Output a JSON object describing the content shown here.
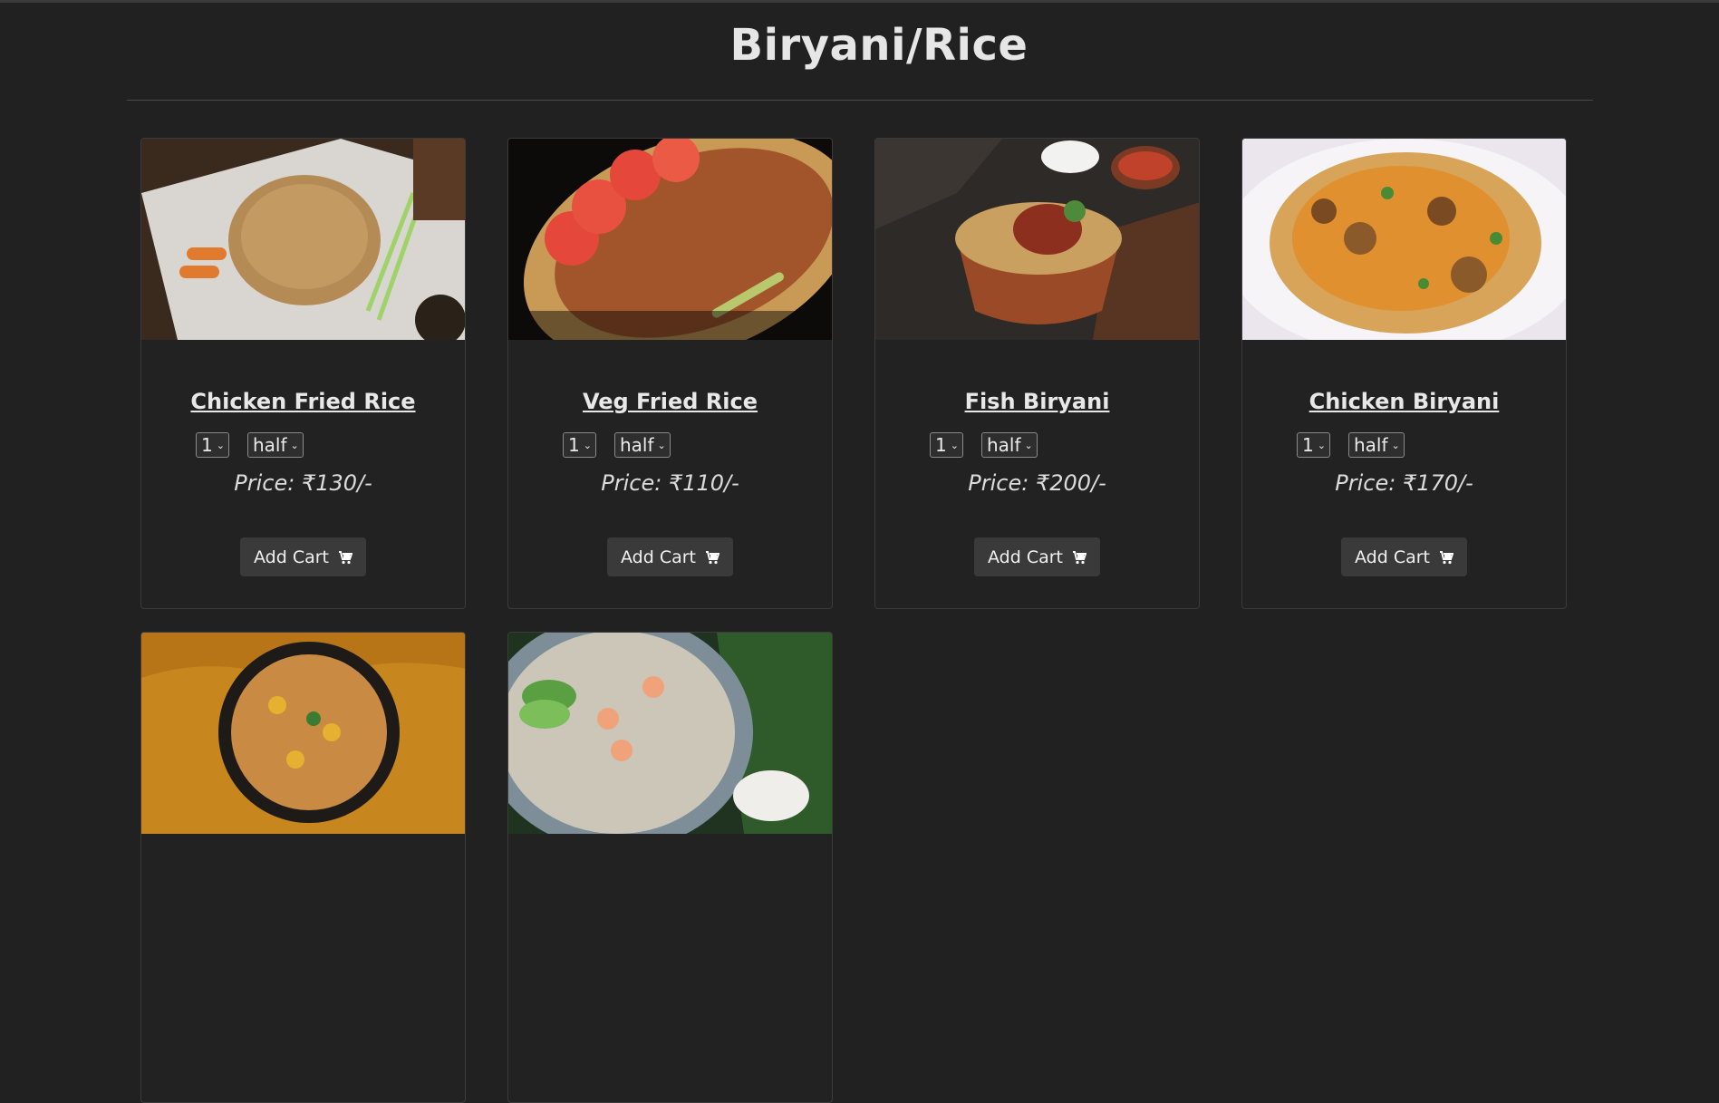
{
  "page": {
    "title": "Biryani/Rice"
  },
  "items": [
    {
      "name": "Chicken Fried Rice",
      "qty": "1",
      "size": "half",
      "price": "Price: ₹130/-",
      "button": "Add Cart"
    },
    {
      "name": "Veg Fried Rice",
      "qty": "1",
      "size": "half",
      "price": "Price: ₹110/-",
      "button": "Add Cart"
    },
    {
      "name": "Fish Biryani",
      "qty": "1",
      "size": "half",
      "price": "Price: ₹200/-",
      "button": "Add Cart"
    },
    {
      "name": "Chicken Biryani",
      "qty": "1",
      "size": "half",
      "price": "Price: ₹170/-",
      "button": "Add Cart"
    }
  ],
  "icons": {
    "cart": "cart-icon",
    "dropdown": "chevron-down-icon"
  }
}
